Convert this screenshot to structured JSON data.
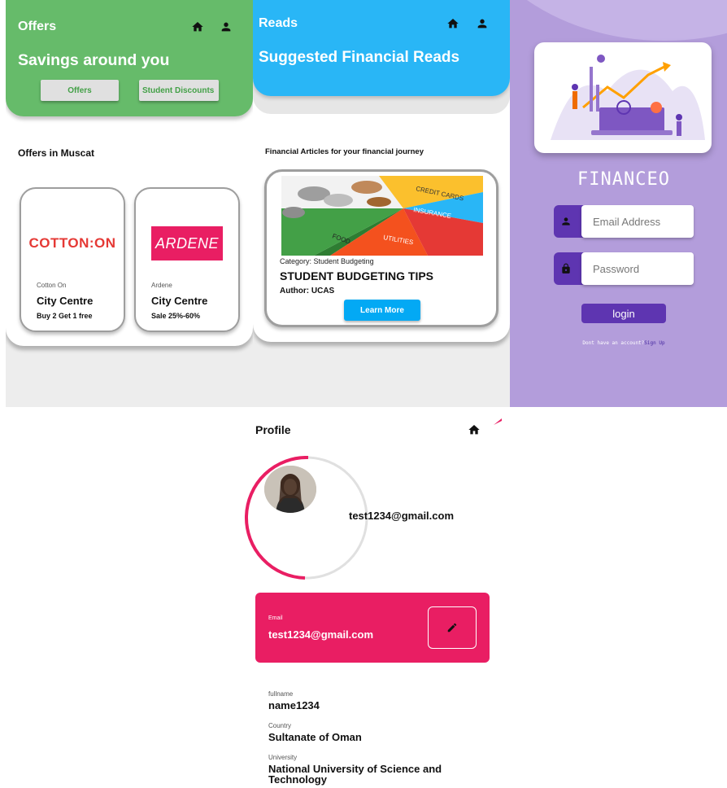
{
  "offers_screen": {
    "appbar_title": "Offers",
    "headline": "Savings around you",
    "buttons": [
      "Offers",
      "Student Discounts"
    ],
    "section_title": "Offers in Muscat",
    "cards": [
      {
        "logo_text": "COTTON:ON",
        "brand": "Cotton On",
        "place": "City Centre",
        "deal": "Buy 2 Get 1 free"
      },
      {
        "logo_text": "ARDENE",
        "brand": "Ardene",
        "place": "City Centre",
        "deal": "Sale 25%-60%"
      }
    ],
    "colors": {
      "header": "#66bb6a",
      "cotton_on_red": "#e53935",
      "ardene_pink": "#e91e63"
    }
  },
  "reads_screen": {
    "appbar_title": "Reads",
    "headline": "Suggested Financial Reads",
    "section_title": "Financial Articles for your financial journey",
    "article": {
      "image_labels": [
        "CREDIT CARDS",
        "INSURANCE",
        "UTILITIES",
        "FOOD"
      ],
      "category": "Category: Student Budgeting",
      "title": "STUDENT BUDGETING TIPS",
      "author": "Author: UCAS",
      "button": "Learn More"
    },
    "colors": {
      "header": "#29b6f6",
      "button": "#03a9f4"
    }
  },
  "login_screen": {
    "app_name": "FINANCEO",
    "email_placeholder": "Email Address",
    "password_placeholder": "Password",
    "login_label": "login",
    "signup_prompt": "Dont have an account?",
    "signup_link": "Sign Up",
    "colors": {
      "background": "#b39ddb",
      "accent": "#5e35b1"
    }
  },
  "profile_screen": {
    "title": "Profile",
    "email_display": "test1234@gmail.com",
    "email_card": {
      "label": "Email",
      "value": "test1234@gmail.com"
    },
    "fields": [
      {
        "label": "fullname",
        "value": "name1234"
      },
      {
        "label": "Country",
        "value": "Sultanate of Oman"
      },
      {
        "label": "University",
        "value": "National University of Science and Technology"
      }
    ],
    "colors": {
      "card": "#e91e63",
      "progress": "#e91e63"
    }
  }
}
